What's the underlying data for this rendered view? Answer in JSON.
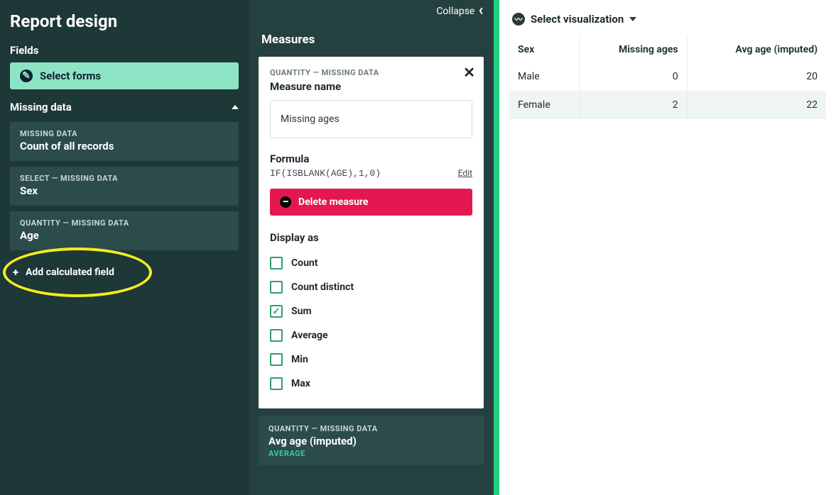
{
  "sidebar": {
    "title": "Report design",
    "fields_label": "Fields",
    "select_forms_label": "Select forms",
    "group_name": "Missing data",
    "add_calc_label": "Add calculated field",
    "fields": [
      {
        "overline": "MISSING DATA",
        "title": "Count of all records"
      },
      {
        "overline": "SELECT — MISSING DATA",
        "title": "Sex"
      },
      {
        "overline": "QUANTITY — MISSING DATA",
        "title": "Age"
      }
    ]
  },
  "measures_panel": {
    "collapse_label": "Collapse",
    "title": "Measures",
    "editor": {
      "overline": "QUANTITY — MISSING DATA",
      "name_label": "Measure name",
      "name_value": "Missing ages",
      "formula_label": "Formula",
      "formula_code": "IF(ISBLANK(AGE),1,0)",
      "formula_edit": "Edit",
      "delete_label": "Delete measure",
      "display_label": "Display as",
      "options": [
        {
          "label": "Count",
          "checked": false
        },
        {
          "label": "Count distinct",
          "checked": false
        },
        {
          "label": "Sum",
          "checked": true
        },
        {
          "label": "Average",
          "checked": false
        },
        {
          "label": "Min",
          "checked": false
        },
        {
          "label": "Max",
          "checked": false
        }
      ]
    },
    "other_measure": {
      "overline": "QUANTITY — MISSING DATA",
      "title": "Avg age (imputed)",
      "agg": "AVERAGE"
    }
  },
  "preview": {
    "select_viz_label": "Select visualization",
    "columns": [
      "Sex",
      "Missing ages",
      "Avg age (imputed)"
    ],
    "rows": [
      {
        "sex": "Male",
        "missing_ages": "0",
        "avg_age": "20"
      },
      {
        "sex": "Female",
        "missing_ages": "2",
        "avg_age": "22"
      }
    ]
  }
}
